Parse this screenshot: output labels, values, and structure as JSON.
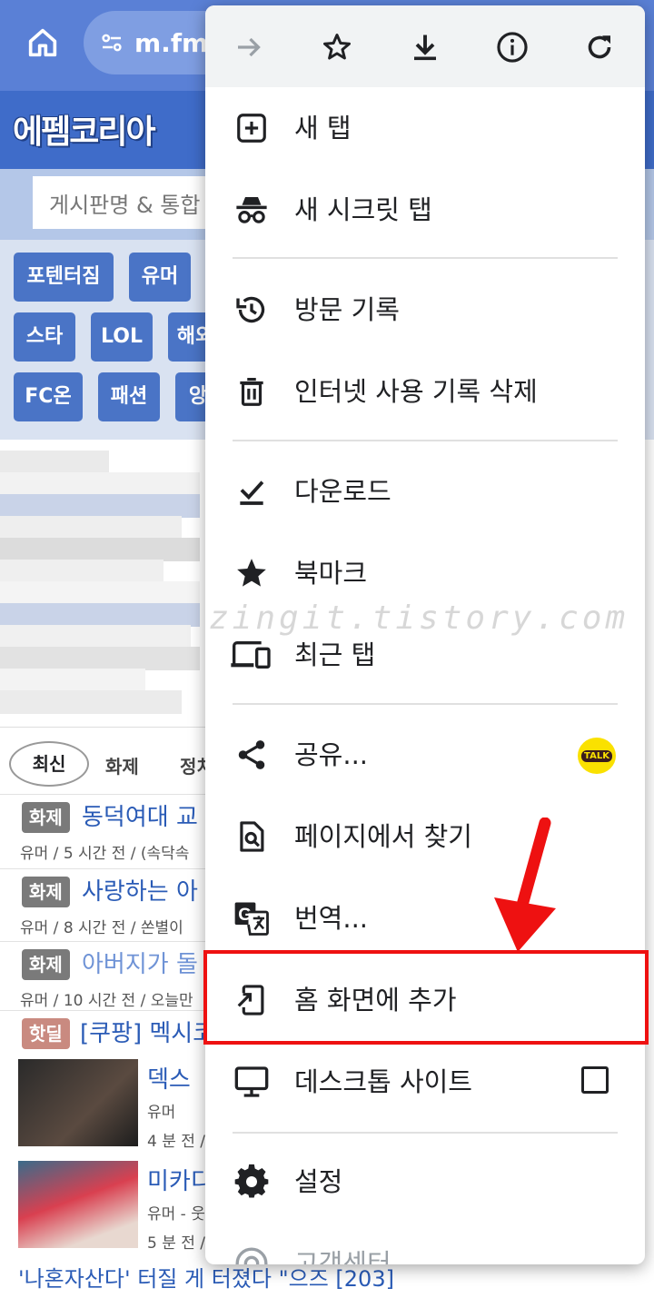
{
  "browser": {
    "url": "m.fm",
    "toolbar": [
      "forward-icon",
      "star-icon",
      "download-icon",
      "info-icon",
      "refresh-icon"
    ]
  },
  "site": {
    "logo": "에펨코리아",
    "search_placeholder": "게시판명 & 통합",
    "tags": [
      "포텐터짐",
      "유머",
      "스타",
      "LOL",
      "해외",
      "FC온",
      "패션",
      "앙"
    ],
    "tabs": [
      "최신",
      "화제",
      "정치"
    ],
    "news": [
      {
        "badge": "화제",
        "title": "동덕여대 교",
        "meta": "유머 / 5 시간 전 / (속닥속"
      },
      {
        "badge": "화제",
        "title": "사랑하는 아",
        "meta": "유머 / 8 시간 전 / 쏜별이"
      },
      {
        "badge": "화제",
        "title": "아버지가 돌",
        "meta": "유머 / 10 시간 전 / 오늘만"
      },
      {
        "badge": "핫딜",
        "title": "[쿠팡] 멕시코",
        "meta": ""
      }
    ],
    "thumbs": [
      {
        "title": "덱스",
        "meta1": "유머",
        "meta2": "4 분 전 /"
      },
      {
        "title": "미카디",
        "meta1": "유머 - 웃",
        "meta2": "5 분 전 /"
      }
    ],
    "bottom_line": "'나혼자산다' 터질 게 터졌다 \"으즈 [203]"
  },
  "menu": {
    "items": [
      {
        "label": "새 탭",
        "icon": "new-tab-icon"
      },
      {
        "label": "새 시크릿 탭",
        "icon": "incognito-icon"
      },
      {
        "label": "방문 기록",
        "icon": "history-icon"
      },
      {
        "label": "인터넷 사용 기록 삭제",
        "icon": "trash-icon"
      },
      {
        "label": "다운로드",
        "icon": "download-done-icon"
      },
      {
        "label": "북마크",
        "icon": "bookmark-star-icon"
      },
      {
        "label": "최근 탭",
        "icon": "devices-icon"
      },
      {
        "label": "공유...",
        "icon": "share-icon",
        "badge": "TALK"
      },
      {
        "label": "페이지에서 찾기",
        "icon": "find-in-page-icon"
      },
      {
        "label": "번역...",
        "icon": "translate-icon"
      },
      {
        "label": "홈 화면에 추가",
        "icon": "add-to-home-icon"
      },
      {
        "label": "데스크톱 사이트",
        "icon": "desktop-icon"
      },
      {
        "label": "설정",
        "icon": "settings-icon"
      },
      {
        "label": "고객센터",
        "icon": "help-icon"
      }
    ]
  },
  "watermark": "zingit.tistory.com",
  "colors": {
    "accent_red": "#ee1111",
    "site_blue": "#3f6cc9",
    "kakao_yellow": "#fae100"
  }
}
